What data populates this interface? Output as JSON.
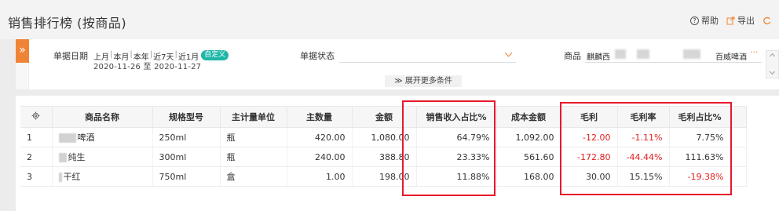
{
  "header": {
    "title": "销售排行榜 (按商品)",
    "help_label": "帮助",
    "export_label": "导出"
  },
  "filters": {
    "expand_icon": "»",
    "date_label": "单据日期",
    "date_options": [
      "上月",
      "本月",
      "本年",
      "近7天",
      "近1月"
    ],
    "custom_label": "自定义",
    "date_range": "2020-11-26 至 2020-11-27",
    "status_label": "单据状态",
    "status_value": "",
    "product_label": "商品",
    "product_values": [
      "麒麟西",
      "百威啤酒"
    ],
    "more_ellipsis": "···",
    "more_conditions": "展开更多条件"
  },
  "table": {
    "settings_icon": "gear-icon",
    "columns": [
      "商品名称",
      "规格型号",
      "主计量单位",
      "主数量",
      "金额",
      "销售收入占比%",
      "成本金额",
      "毛利",
      "毛利率",
      "毛利占比%"
    ],
    "rows": [
      {
        "index": "1",
        "name": "啤酒",
        "spec": "250ml",
        "unit": "瓶",
        "qty": "420.00",
        "amount": "1,080.00",
        "revenue_pct": "64.79%",
        "cost": "1,092.00",
        "profit": "-12.00",
        "margin": "-1.11%",
        "profit_pct": "7.75%"
      },
      {
        "index": "2",
        "name": "纯生",
        "spec": "300ml",
        "unit": "瓶",
        "qty": "240.00",
        "amount": "388.80",
        "revenue_pct": "23.33%",
        "cost": "561.60",
        "profit": "-172.80",
        "margin": "-44.44%",
        "profit_pct": "111.63%"
      },
      {
        "index": "3",
        "name": "干红",
        "spec": "750ml",
        "unit": "盒",
        "qty": "1.00",
        "amount": "198.00",
        "revenue_pct": "11.88%",
        "cost": "168.00",
        "profit": "30.00",
        "margin": "15.15%",
        "profit_pct": "-19.38%"
      }
    ]
  },
  "colors": {
    "accent": "#f08436",
    "custom_chip": "#1db6a7",
    "negative": "#e0201f",
    "highlight_box": "#e8182b"
  }
}
